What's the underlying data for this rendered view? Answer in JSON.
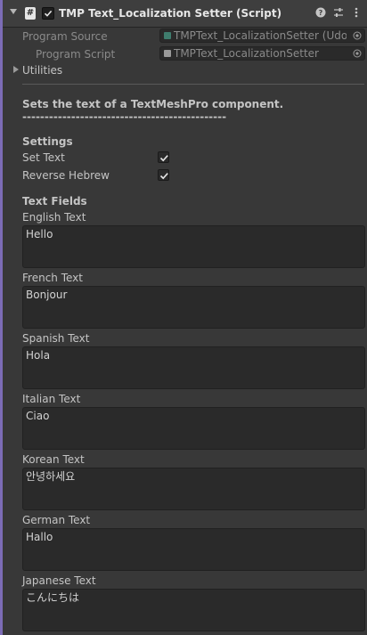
{
  "component": {
    "title": "TMP Text_Localization Setter (Script)",
    "icons": [
      "hash-script-icon",
      "enabled-checkbox-icon",
      "help-icon",
      "preset-icon",
      "kebab-menu-icon"
    ]
  },
  "program_source": {
    "label": "Program Source",
    "value": "TMPText_LocalizationSetter (Udon"
  },
  "program_script": {
    "label": "Program Script",
    "value": "TMPText_LocalizationSetter"
  },
  "utilities": {
    "label": "Utilities"
  },
  "description": {
    "text": "Sets the text of a TextMeshPro component.",
    "dashes": "----------------------------------------------"
  },
  "settings": {
    "header": "Settings",
    "set_text": {
      "label": "Set Text",
      "checked": true
    },
    "reverse_hebrew": {
      "label": "Reverse Hebrew",
      "checked": true
    }
  },
  "text_fields": {
    "header": "Text Fields",
    "items": [
      {
        "label": "English Text",
        "value": "Hello"
      },
      {
        "label": "French Text",
        "value": "Bonjour"
      },
      {
        "label": "Spanish Text",
        "value": "Hola"
      },
      {
        "label": "Italian Text",
        "value": "Ciao"
      },
      {
        "label": "Korean Text",
        "value": "안녕하세요"
      },
      {
        "label": "German Text",
        "value": "Hallo"
      },
      {
        "label": "Japanese Text",
        "value": "こんにちは"
      }
    ]
  },
  "colors": {
    "accent_bar": "#7c6cb6",
    "background": "#383838",
    "field_bg": "#2a2a2a"
  }
}
